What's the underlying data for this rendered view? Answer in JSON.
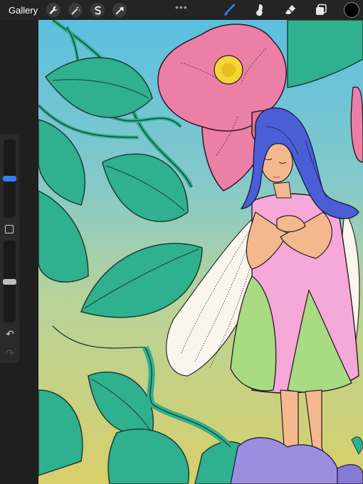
{
  "topbar": {
    "gallery_label": "Gallery",
    "left_tools": [
      {
        "name": "wrench-icon"
      },
      {
        "name": "magic-wand-icon"
      },
      {
        "name": "selection-icon"
      },
      {
        "name": "transform-arrow-icon"
      }
    ],
    "right_tools": [
      {
        "name": "brush-icon",
        "active": true
      },
      {
        "name": "smudge-icon",
        "active": false
      },
      {
        "name": "eraser-icon",
        "active": false
      },
      {
        "name": "layers-icon",
        "active": false
      }
    ],
    "current_color": "#000000",
    "active_color": "#2f7ff5"
  },
  "sidebar": {
    "brush_size_level": 0.5,
    "opacity_level": 0.5,
    "accent": "#2f7ff5"
  }
}
